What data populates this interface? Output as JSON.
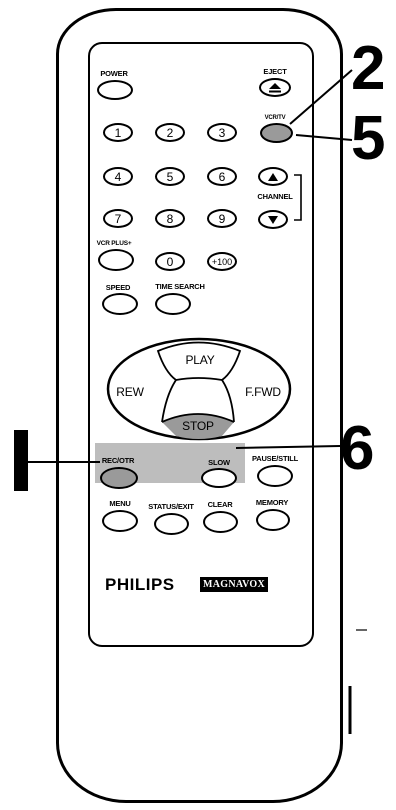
{
  "buttons": {
    "power": "POWER",
    "eject": "EJECT",
    "vcr_tv": "VCR/TV",
    "channel": "CHANNEL",
    "vcr_plus": "VCR PLUS+",
    "speed": "SPEED",
    "time_search": "TIME SEARCH",
    "play": "PLAY",
    "rew": "REW",
    "ffwd": "F.FWD",
    "stop": "STOP",
    "rec_otr": "REC/OTR",
    "slow": "SLOW",
    "pause_still": "PAUSE/STILL",
    "menu": "MENU",
    "status_exit": "STATUS/EXIT",
    "clear": "CLEAR",
    "memory": "MEMORY"
  },
  "keypad": [
    "1",
    "2",
    "3",
    "4",
    "5",
    "6",
    "7",
    "8",
    "9",
    "0",
    "+100"
  ],
  "brand": {
    "philips": "PHILIPS",
    "magnavox": "MAGNAVOX"
  },
  "steps": {
    "s2": "2",
    "s5": "5",
    "s6": "6",
    "s1": "1"
  }
}
